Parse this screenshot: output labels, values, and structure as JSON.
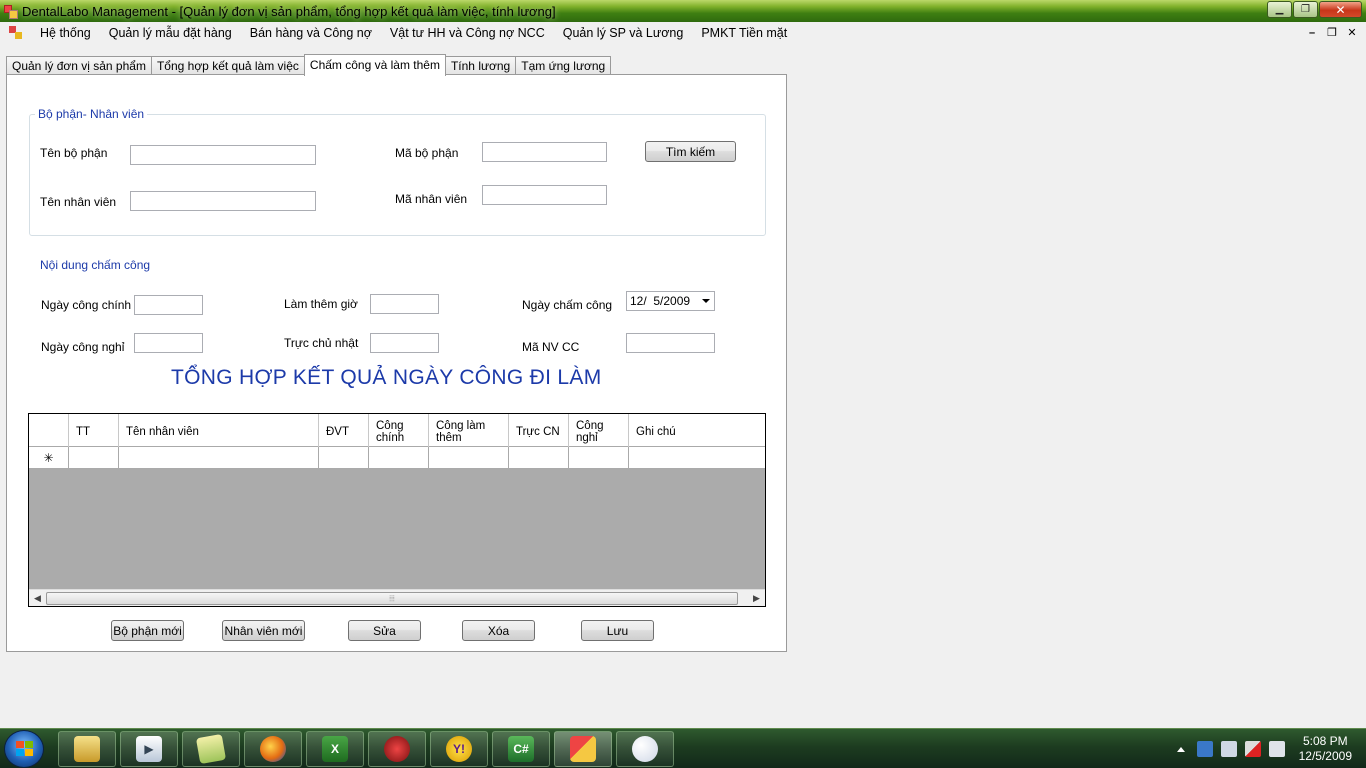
{
  "window": {
    "title": "DentalLabo Management - [Quản lý đơn vị sản phẩm, tổng hợp kết quả làm việc, tính lương]"
  },
  "menu": {
    "items": [
      "Hệ thống",
      "Quản lý mẫu đặt hàng",
      "Bán hàng và Công nợ",
      "Vật tư HH và Công nợ NCC",
      "Quản lý SP và Lương",
      "PMKT Tiền mặt"
    ]
  },
  "tabs": [
    {
      "label": "Quản lý đơn vị sản phẩm",
      "active": false
    },
    {
      "label": "Tổng hợp kết quả làm việc",
      "active": false
    },
    {
      "label": "Chấm công và làm thêm",
      "active": true
    },
    {
      "label": "Tính lương",
      "active": false
    },
    {
      "label": "Tạm ứng lương",
      "active": false
    }
  ],
  "dept_group": {
    "title": "Bộ phận- Nhân viên",
    "dept_name_label": "Tên bộ phận",
    "dept_name_value": "",
    "dept_code_label": "Mã bộ phận",
    "dept_code_value": "",
    "search_button": "Tìm kiếm",
    "emp_name_label": "Tên nhân viên",
    "emp_name_value": "",
    "emp_code_label": "Mã nhân viên",
    "emp_code_value": ""
  },
  "attendance": {
    "title": "Nội dung chấm công",
    "main_days_label": "Ngày công chính",
    "main_days_value": "",
    "overtime_label": "Làm thêm giờ",
    "overtime_value": "",
    "date_label": "Ngày chấm công",
    "date_value": "12/  5/2009",
    "off_days_label": "Ngày công nghỉ",
    "off_days_value": "",
    "sunday_label": "Trực chủ nhật",
    "sunday_value": "",
    "emp_cc_label": "Mã NV CC",
    "emp_cc_value": ""
  },
  "summary_title": "TỔNG HỢP KẾT QUẢ NGÀY CÔNG ĐI LÀM",
  "grid": {
    "columns": [
      "TT",
      "Tên nhân viên",
      "ĐVT",
      "Công chính",
      "Công làm thêm",
      "Trực CN",
      "Công nghỉ",
      "Ghi chú"
    ],
    "new_row_marker": "✳",
    "scroll_grip": "⦙⦙⦙"
  },
  "actions": {
    "new_dept": "Bộ phận mới",
    "new_emp": "Nhân viên mới",
    "edit": "Sửa",
    "delete": "Xóa",
    "save": "Lưu"
  },
  "taskbar": {
    "apps": [
      "file-explorer-icon",
      "media-player-icon",
      "folder-icon",
      "firefox-icon",
      "excel-icon",
      "game-icon",
      "yahoo-messenger-icon",
      "csharp-icon",
      "app-icon",
      "paint-icon"
    ],
    "time": "5:08 PM",
    "date": "12/5/2009"
  },
  "colors": {
    "titlebar": "#3f7f12",
    "label_blue": "#1c3aa9",
    "taskbar": "#1d3c20"
  }
}
